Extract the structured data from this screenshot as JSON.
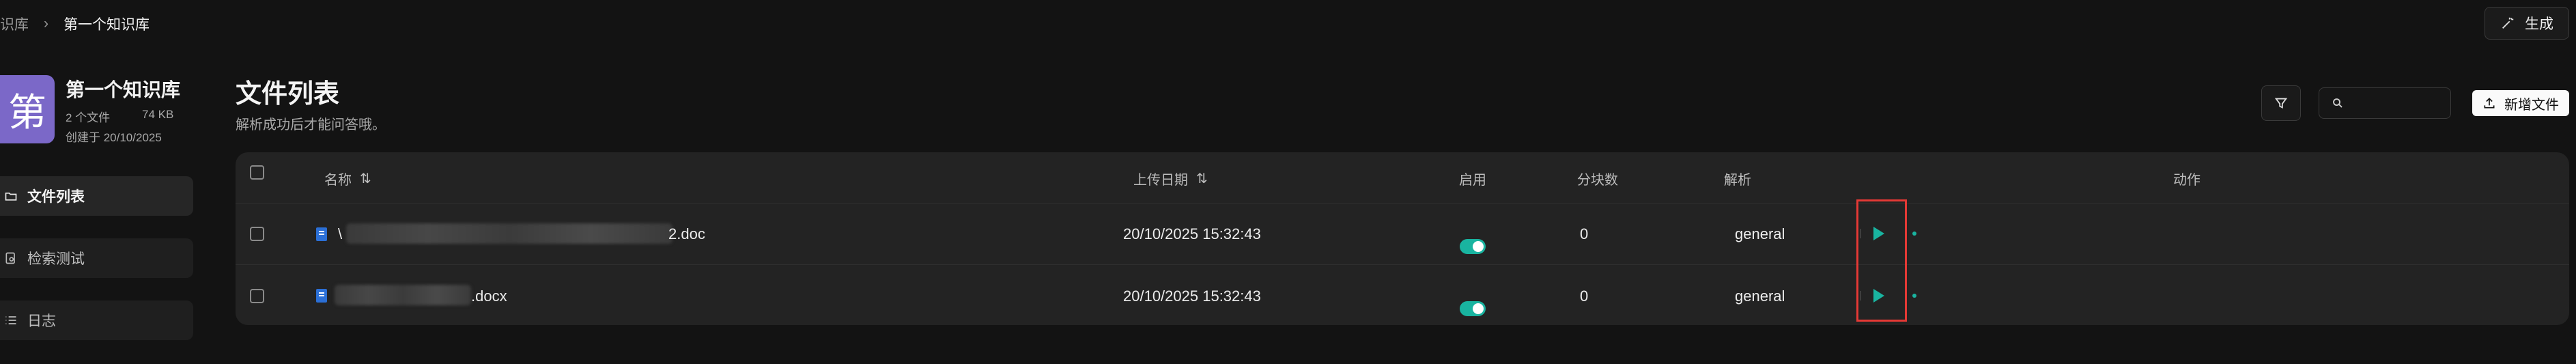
{
  "breadcrumb": {
    "parent": "识库",
    "current": "第一个知识库"
  },
  "header": {
    "generate_label": "生成"
  },
  "kb": {
    "avatar_char": "第",
    "name": "第一个知识库",
    "file_count": "2 个文件",
    "size": "74 KB",
    "created": "创建于 20/10/2025"
  },
  "sidebar": {
    "items": [
      {
        "label": "文件列表",
        "icon": "folder-open-icon",
        "active": true
      },
      {
        "label": "检索测试",
        "icon": "search-doc-icon",
        "active": false
      },
      {
        "label": "日志",
        "icon": "list-icon",
        "active": false
      }
    ]
  },
  "main": {
    "title": "文件列表",
    "subtitle": "解析成功后才能问答哦。",
    "search_placeholder": "",
    "add_button_label": "新增文件"
  },
  "table": {
    "columns": [
      "名称",
      "上传日期",
      "启用",
      "分块数",
      "解析",
      "动作"
    ],
    "rows": [
      {
        "name_prefix": "\\",
        "name_suffix": "2.doc",
        "date": "20/10/2025 15:32:43",
        "enabled": true,
        "chunks": "0",
        "parser": "general"
      },
      {
        "name_prefix": "",
        "name_suffix": ".docx",
        "date": "20/10/2025 15:32:43",
        "enabled": true,
        "chunks": "0",
        "parser": "general"
      }
    ]
  },
  "colors": {
    "accent": "#19b4a0",
    "avatar": "#7b68c8",
    "highlight": "#e53935"
  }
}
